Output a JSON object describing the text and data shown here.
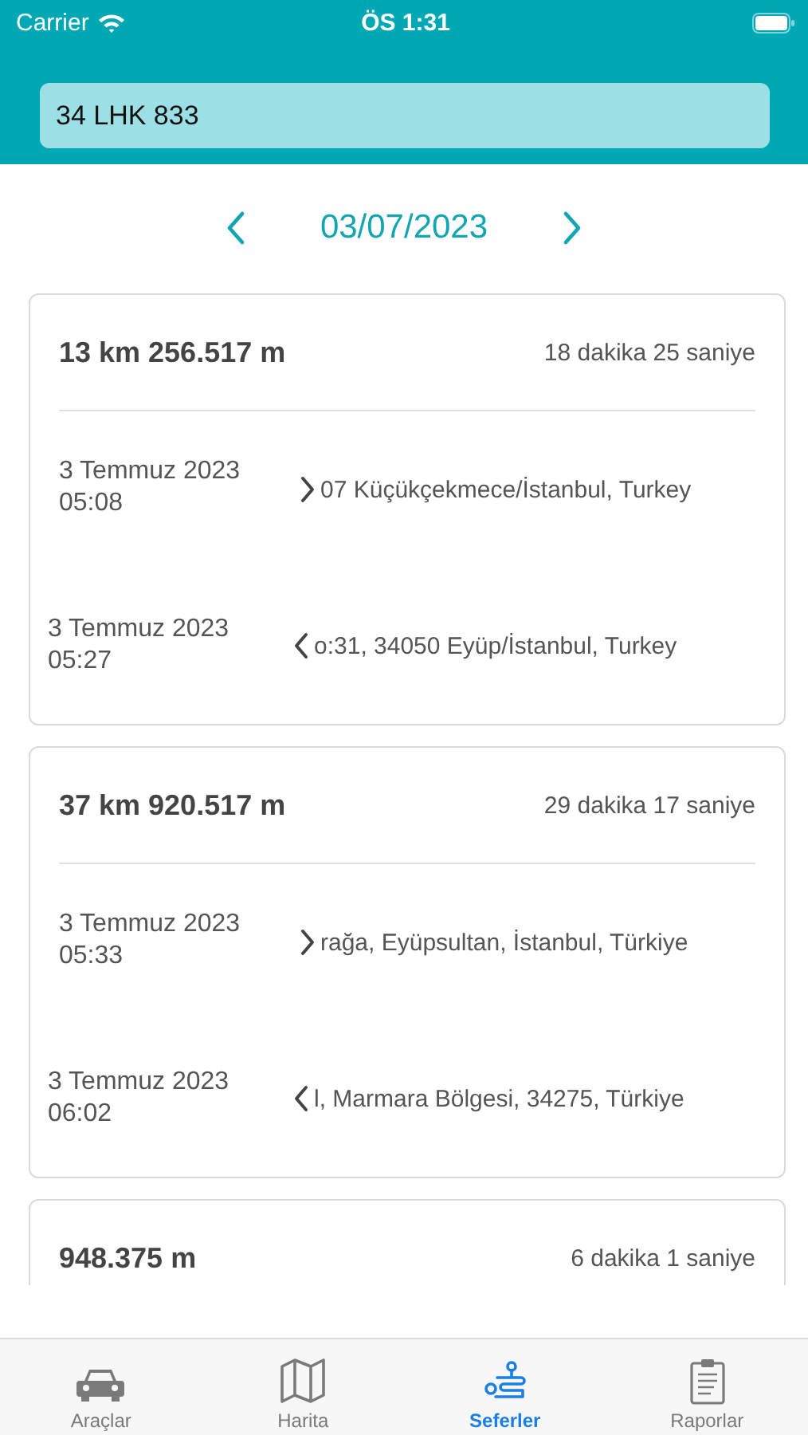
{
  "status_bar": {
    "carrier": "Carrier",
    "time": "ÖS 1:31"
  },
  "vehicle_field": {
    "value": "34 LHK 833"
  },
  "date_nav": {
    "date": "03/07/2023"
  },
  "trips": [
    {
      "distance": "13 km 256.517 m",
      "duration": "18 dakika 25 saniye",
      "stops": [
        {
          "kind": "start",
          "date": "3 Temmuz 2023",
          "time": "05:08",
          "address": "07 Küçükçekmece/İstanbul, Turkey"
        },
        {
          "kind": "end",
          "date": "3 Temmuz 2023",
          "time": "05:27",
          "address": "o:31, 34050 Eyüp/İstanbul, Turkey"
        }
      ]
    },
    {
      "distance": "37 km 920.517 m",
      "duration": "29 dakika 17 saniye",
      "stops": [
        {
          "kind": "start",
          "date": "3 Temmuz 2023",
          "time": "05:33",
          "address": "rağa, Eyüpsultan, İstanbul, Türkiye"
        },
        {
          "kind": "end",
          "date": "3 Temmuz 2023",
          "time": "06:02",
          "address": "l, Marmara Bölgesi, 34275, Türkiye"
        }
      ]
    },
    {
      "distance": "948.375 m",
      "duration": "6 dakika 1 saniye"
    }
  ],
  "tab_bar": [
    {
      "label": "Araçlar",
      "kind": "car",
      "selected": false
    },
    {
      "label": "Harita",
      "kind": "map",
      "selected": false
    },
    {
      "label": "Seferler",
      "kind": "route",
      "selected": true
    },
    {
      "label": "Raporlar",
      "kind": "clipboard",
      "selected": false
    }
  ]
}
